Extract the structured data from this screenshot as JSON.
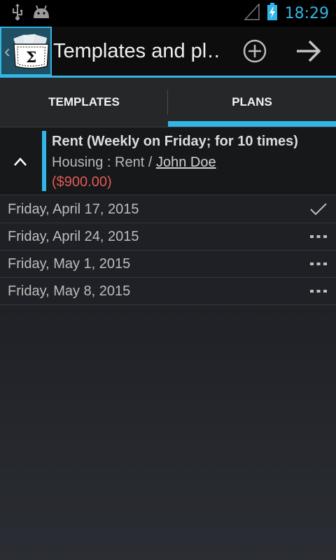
{
  "status_bar": {
    "time": "18:29",
    "icons": [
      "usb-icon",
      "android-debug-icon",
      "signal-icon",
      "battery-charging-icon"
    ]
  },
  "action_bar": {
    "title": "Templates and pl…",
    "app_icon": "sigma-wallet-icon",
    "actions": [
      "add-icon",
      "arrow-right-icon"
    ]
  },
  "tabs": [
    {
      "label": "TEMPLATES",
      "selected": false
    },
    {
      "label": "PLANS",
      "selected": true
    }
  ],
  "plan": {
    "title": "Rent (Weekly on Friday; for 10 times)",
    "category": "Housing : Rent / ",
    "payee": "John Doe",
    "amount": "($900.00)",
    "amount_color": "#e15a55",
    "accent_color": "#33b5e5"
  },
  "instances": [
    {
      "date": "Friday, April 17, 2015",
      "status": "applied"
    },
    {
      "date": "Friday, April 24, 2015",
      "status": "open"
    },
    {
      "date": "Friday, May 1, 2015",
      "status": "open"
    },
    {
      "date": "Friday, May 8, 2015",
      "status": "open"
    }
  ]
}
